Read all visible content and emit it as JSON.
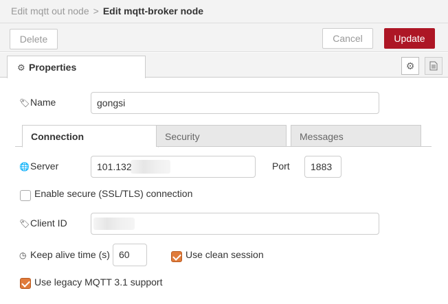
{
  "breadcrumb": {
    "parent": "Edit mqtt out node",
    "separator": ">",
    "current": "Edit mqtt-broker node"
  },
  "toolbar": {
    "delete_label": "Delete",
    "cancel_label": "Cancel",
    "update_label": "Update",
    "update_color": "#ad1625"
  },
  "tabs": {
    "properties_label": "Properties"
  },
  "form": {
    "name_label": "Name",
    "name_value": "gongsi",
    "subtabs": [
      "Connection",
      "Security",
      "Messages"
    ],
    "server_label": "Server",
    "server_value": "101.132",
    "port_label": "Port",
    "port_value": "1883",
    "ssl_label": "Enable secure (SSL/TLS) connection",
    "ssl_checked": false,
    "clientid_label": "Client ID",
    "clientid_value": "",
    "keepalive_label": "Keep alive time (s)",
    "keepalive_value": "60",
    "clean_session_label": "Use clean session",
    "clean_session_checked": true,
    "legacy_label": "Use legacy MQTT 3.1 support",
    "legacy_checked": true,
    "check_color": "#e07b3a"
  },
  "icons": {
    "properties": "gear-icon",
    "settings": "gear-icon",
    "description": "document-icon",
    "name": "tag-icon",
    "server": "globe-icon",
    "clientid": "tag-icon",
    "keepalive": "clock-icon"
  }
}
